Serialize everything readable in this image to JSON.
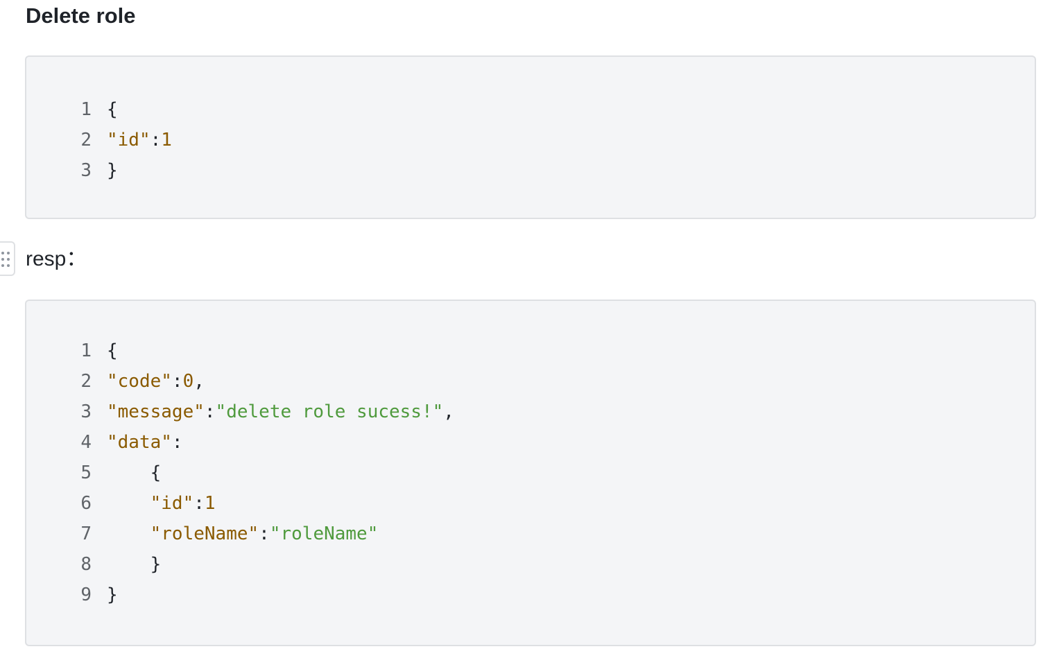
{
  "page": {
    "heading": "Delete role",
    "resp_label": "resp："
  },
  "request_block": {
    "lines": [
      {
        "num": "1",
        "tokens": [
          {
            "t": "{",
            "c": "p"
          }
        ]
      },
      {
        "num": "2",
        "tokens": [
          {
            "t": "\"id\"",
            "c": "k"
          },
          {
            "t": ":",
            "c": "p"
          },
          {
            "t": "1",
            "c": "k"
          }
        ]
      },
      {
        "num": "3",
        "tokens": [
          {
            "t": "}",
            "c": "p"
          }
        ]
      }
    ]
  },
  "response_block": {
    "lines": [
      {
        "num": "1",
        "tokens": [
          {
            "t": "{",
            "c": "p"
          }
        ]
      },
      {
        "num": "2",
        "tokens": [
          {
            "t": "\"code\"",
            "c": "k"
          },
          {
            "t": ":",
            "c": "p"
          },
          {
            "t": "0",
            "c": "k"
          },
          {
            "t": ",",
            "c": "p"
          }
        ]
      },
      {
        "num": "3",
        "tokens": [
          {
            "t": "\"message\"",
            "c": "k"
          },
          {
            "t": ":",
            "c": "p"
          },
          {
            "t": "\"delete role sucess!\"",
            "c": "s"
          },
          {
            "t": ",",
            "c": "p"
          }
        ]
      },
      {
        "num": "4",
        "tokens": [
          {
            "t": "\"data\"",
            "c": "k"
          },
          {
            "t": ":",
            "c": "p"
          }
        ]
      },
      {
        "num": "5",
        "tokens": [
          {
            "t": "    {",
            "c": "p"
          }
        ]
      },
      {
        "num": "6",
        "tokens": [
          {
            "t": "    ",
            "c": "p"
          },
          {
            "t": "\"id\"",
            "c": "k"
          },
          {
            "t": ":",
            "c": "p"
          },
          {
            "t": "1",
            "c": "k"
          }
        ]
      },
      {
        "num": "7",
        "tokens": [
          {
            "t": "    ",
            "c": "p"
          },
          {
            "t": "\"roleName\"",
            "c": "k"
          },
          {
            "t": ":",
            "c": "p"
          },
          {
            "t": "\"roleName\"",
            "c": "s"
          }
        ]
      },
      {
        "num": "8",
        "tokens": [
          {
            "t": "    }",
            "c": "p"
          }
        ]
      },
      {
        "num": "9",
        "tokens": [
          {
            "t": "}",
            "c": "p"
          }
        ]
      }
    ]
  },
  "icons": {
    "drag_handle": "drag-handle-icon"
  },
  "colors": {
    "code_background": "#f4f5f7",
    "code_border": "#dee0e3",
    "json_key": "#8a5a00",
    "json_string": "#4f9a3d",
    "line_number": "#5f6368",
    "text": "#1f2329"
  }
}
